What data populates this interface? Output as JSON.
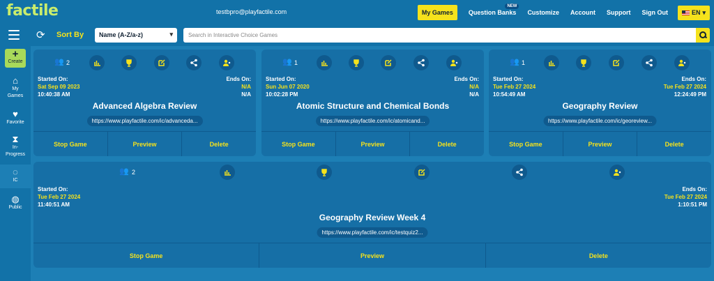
{
  "app": {
    "logo": "factile",
    "email": "testbpro@playfactile.com"
  },
  "nav": {
    "my_games": "My Games",
    "question_banks": "Question Banks",
    "new_badge": "NEW",
    "customize": "Customize",
    "account": "Account",
    "support": "Support",
    "sign_out": "Sign Out",
    "lang": "EN"
  },
  "toolbar": {
    "sort_label": "Sort By",
    "sort_value": "Name (A-Z/a-z)",
    "search_placeholder": "Search in Interactive Choice Games"
  },
  "sidebar": {
    "create": "Create",
    "items": [
      {
        "label": "My Games",
        "icon": "home-icon"
      },
      {
        "label": "Favorite",
        "icon": "heart-icon"
      },
      {
        "label": "In-Progress",
        "icon": "hourglass-icon"
      },
      {
        "label": "IC",
        "icon": "ic-icon"
      },
      {
        "label": "Public",
        "icon": "globe-icon"
      }
    ]
  },
  "labels": {
    "started": "Started On:",
    "ends": "Ends On:",
    "stop": "Stop Game",
    "preview": "Preview",
    "delete": "Delete"
  },
  "games": [
    {
      "players": "2",
      "title": "Advanced Algebra Review",
      "start_date": "Sat Sep 09 2023",
      "start_time": "10:40:38 AM",
      "end_date": "N/A",
      "end_time": "N/A",
      "url": "https://www.playfactile.com/ic/advanceda..."
    },
    {
      "players": "1",
      "title": "Atomic Structure and Chemical Bonds",
      "start_date": "Sun Jun 07 2020",
      "start_time": "10:02:28 PM",
      "end_date": "N/A",
      "end_time": "N/A",
      "url": "https://www.playfactile.com/ic/atomicand..."
    },
    {
      "players": "1",
      "title": "Geography Review",
      "start_date": "Tue Feb 27 2024",
      "start_time": "10:54:49 AM",
      "end_date": "Tue Feb 27 2024",
      "end_time": "12:24:49 PM",
      "url": "https://www.playfactile.com/ic/georeview..."
    },
    {
      "players": "2",
      "title": "Geography Review Week 4",
      "start_date": "Tue Feb 27 2024",
      "start_time": "11:40:51 AM",
      "end_date": "Tue Feb 27 2024",
      "end_time": "1:10:51 PM",
      "url": "https://www.playfactile.com/ic/testquiz2..."
    }
  ],
  "colors": {
    "bg": "#1d7fb5",
    "bar": "#1272a8",
    "accent": "#f5e21c",
    "logo": "#c9ec6c"
  }
}
